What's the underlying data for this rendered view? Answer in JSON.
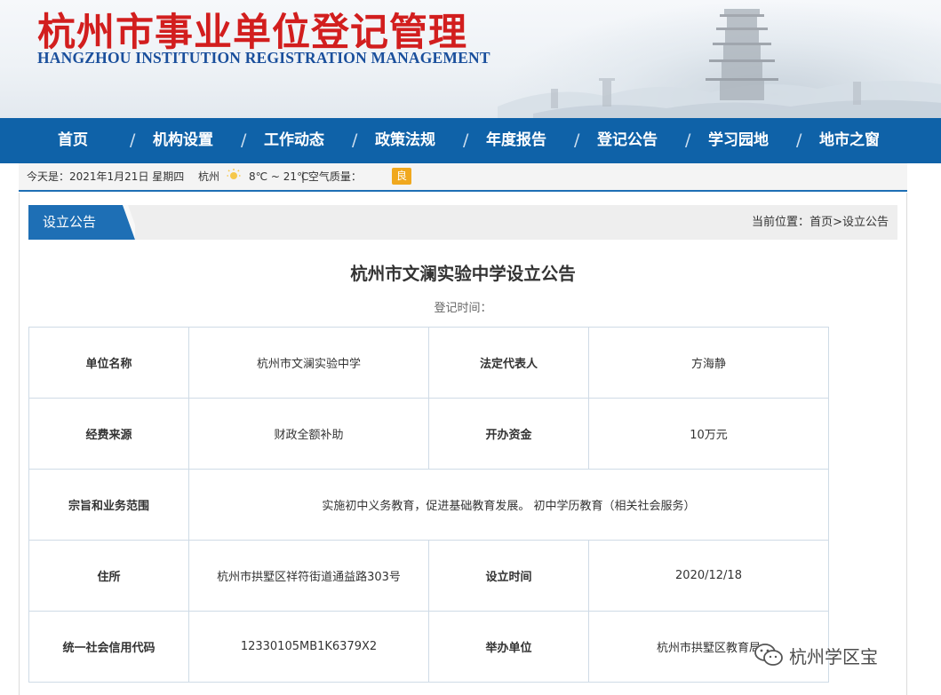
{
  "header": {
    "title": "杭州市事业单位登记管理",
    "subtitle": "HANGZHOU INSTITUTION REGISTRATION MANAGEMENT"
  },
  "nav": {
    "items": [
      "首页",
      "机构设置",
      "工作动态",
      "政策法规",
      "年度报告",
      "登记公告",
      "学习园地",
      "地市之窗"
    ],
    "separator": "/"
  },
  "infobar": {
    "date_text": "今天是：2021年1月21日 星期四",
    "city": "杭州",
    "weather_icon": "sun-icon",
    "temperature": "8℃ ~ 21℃",
    "air_quality_label": "| 空气质量：",
    "air_quality_value": "良"
  },
  "section": {
    "tab_label": "设立公告",
    "breadcrumb_prefix": "当前位置：",
    "breadcrumb_home": "首页",
    "breadcrumb_sep": ">",
    "breadcrumb_current": "设立公告"
  },
  "article": {
    "title": "杭州市文澜实验中学设立公告",
    "registration_time": "登记时间："
  },
  "table": {
    "unit_name_label": "单位名称",
    "unit_name": "杭州市文澜实验中学",
    "legal_rep_label": "法定代表人",
    "legal_rep": "方海静",
    "funding_source_label": "经费来源",
    "funding_source": "财政全额补助",
    "start_capital_label": "开办资金",
    "start_capital": "10万元",
    "scope_label": "宗旨和业务范围",
    "scope": "实施初中义务教育，促进基础教育发展。 初中学历教育（相关社会服务）",
    "address_label": "住所",
    "address": "杭州市拱墅区祥符街道通益路303号",
    "established_label": "设立时间",
    "established": "2020/12/18",
    "credit_code_label": "统一社会信用代码",
    "credit_code": "12330105MB1K6379X2",
    "sponsor_label": "举办单位",
    "sponsor": "杭州市拱墅区教育局"
  },
  "watermark": {
    "icon": "wechat-icon",
    "text": "杭州学区宝"
  },
  "colors": {
    "title_red": "#d21e1e",
    "subtitle_blue": "#1a4f9c",
    "nav_blue": "#0f62a8",
    "tab_blue": "#1e6fb5",
    "aqi_orange": "#f0a81e"
  }
}
